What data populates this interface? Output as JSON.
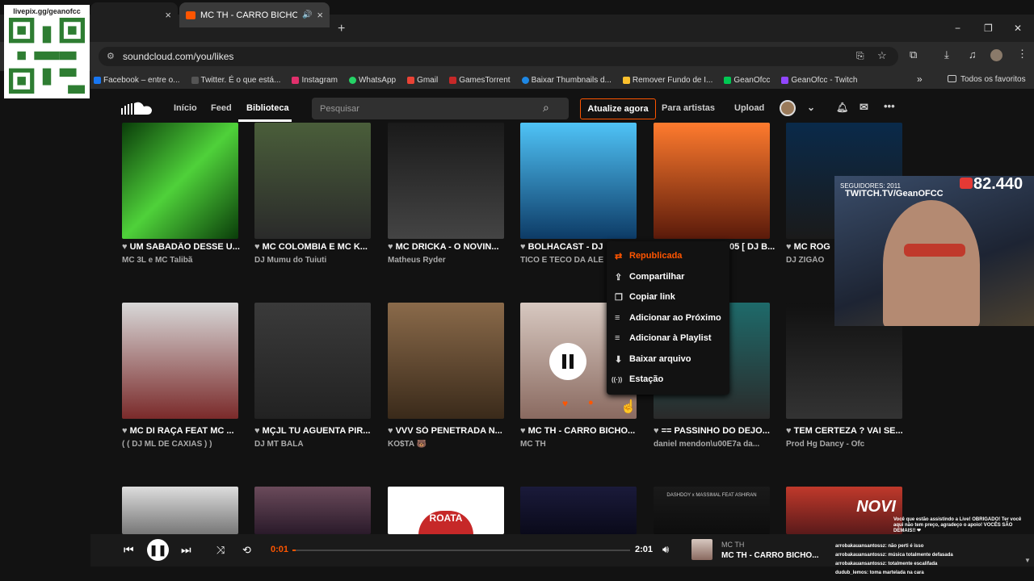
{
  "overlay": {
    "qr_caption": "livepix.gg/geanofcc",
    "followers_label": "SEGUIDORES: 2011",
    "twitch_url": "TWITCH.TV/GeanOFCC",
    "viewer_count": "82.440"
  },
  "tabs": [
    {
      "label": "",
      "close": "×"
    },
    {
      "label": "MC TH - CARRO BICHO DO",
      "close": "×"
    }
  ],
  "new_tab": "+",
  "window_controls": [
    "−",
    "❐",
    "✕"
  ],
  "url": "soundcloud.com/you/likes",
  "bookmarks": [
    {
      "label": "Facebook – entre o...",
      "color": "#1877f2"
    },
    {
      "label": "Twitter. É o que está...",
      "color": "#111111"
    },
    {
      "label": "Instagram",
      "color": "#e1306c"
    },
    {
      "label": "WhatsApp",
      "color": "#25d366"
    },
    {
      "label": "Gmail",
      "color": "#ea4335"
    },
    {
      "label": "GamesTorrent",
      "color": "#c62828"
    },
    {
      "label": "Baixar Thumbnails d...",
      "color": "#1e88e5"
    },
    {
      "label": "Remover Fundo de I...",
      "color": "#fbc02d"
    },
    {
      "label": "GeanOfcc",
      "color": "#00c853"
    },
    {
      "label": "GeanOfcc - Twitch",
      "color": "#9146ff"
    }
  ],
  "bookmarks_more": "»",
  "all_bookmarks": "Todos os favoritos",
  "nav": {
    "home": "Início",
    "feed": "Feed",
    "library": "Biblioteca",
    "search_placeholder": "Pesquisar",
    "upgrade": "Atualize agora",
    "artists": "Para artistas",
    "upload": "Upload"
  },
  "tracks_row1": [
    {
      "title": "UM SABADÃO DESSE U...",
      "artist": "MC 3L e MC Talibã",
      "bg": "linear-gradient(135deg,#0a3d0a,#4fd13a,#0a3d0a)"
    },
    {
      "title": "MC COLOMBIA E MC K...",
      "artist": "DJ Mumu do Tuiuti",
      "bg": "linear-gradient(180deg,#4a5e3a,#2a2a2a)"
    },
    {
      "title": "MC DRICKA - O NOVIN...",
      "artist": "Matheus Ryder",
      "bg": "linear-gradient(180deg,#1a1a1a,#444)"
    },
    {
      "title": "BOLHACAST - DJ",
      "artist": "TICO E TECO DA ALE",
      "bg": "linear-gradient(180deg,#4fc3f7,#0d3b66)"
    },
    {
      "title": "05 [ DJ B...",
      "artist": "",
      "bg": "linear-gradient(180deg,#ff7b2e,#5a1a0a)"
    },
    {
      "title": "MC ROG",
      "artist": "DJ ZIGÃO",
      "bg": "linear-gradient(180deg,#0a2a4a,#1a1a1a)"
    }
  ],
  "tracks_row2": [
    {
      "title": "MC DI RAÇA FEAT MC ...",
      "artist": "( ( DJ ML DE CAXIAS ) )",
      "bg": "linear-gradient(180deg,#d8d8d8,#7a2a2a)"
    },
    {
      "title": "MÇJL TU AGUENTA PIR...",
      "artist": "DJ MT BALA",
      "bg": "linear-gradient(180deg,#3a3a3a,#222)"
    },
    {
      "title": "VVV SÓ PENETRADA N...",
      "artist": "KO$TA 🐻",
      "bg": "linear-gradient(180deg,#8a6a4a,#3a2a1a)"
    },
    {
      "title": "MC TH - CARRO BICHO...",
      "artist": "MC TH",
      "bg": "linear-gradient(180deg,#d7c8c0,#8a6a60)"
    },
    {
      "title": "== PASSINHO DO DEJO...",
      "artist": "daniel mendon\\u00E7a da...",
      "bg": "linear-gradient(180deg,#1e6a6a,#2a2a2a)"
    },
    {
      "title": "TEM CERTEZA ? VAI SE...",
      "artist": "Prod Hg Dancy - Ofc",
      "bg": "linear-gradient(180deg,#111,#333)"
    }
  ],
  "tracks_row3": [
    {
      "bg": "linear-gradient(180deg,#ddd,#777)"
    },
    {
      "bg": "linear-gradient(180deg,#6a4a5a,#2a1a2a)"
    },
    {
      "bg": "#ffffff",
      "label": "ROATA"
    },
    {
      "bg": "linear-gradient(180deg,#1a1a3a,#0a0a1a)"
    },
    {
      "bg": "linear-gradient(180deg,#1a1a1a,#0d0d0d)",
      "label": "DASHDOY x MASSIMAL FEAT ASHIRAN"
    },
    {
      "bg": "linear-gradient(180deg,#c0392b,#5a1a1a)",
      "label": "NOVI"
    }
  ],
  "context_menu": [
    {
      "icon": "⇄",
      "label": "Republicada",
      "active": true
    },
    {
      "icon": "⇪",
      "label": "Compartilhar"
    },
    {
      "icon": "❐",
      "label": "Copiar link"
    },
    {
      "icon": "≡",
      "label": "Adicionar ao Próximo"
    },
    {
      "icon": "≡",
      "label": "Adicionar à Playlist"
    },
    {
      "icon": "⬇",
      "label": "Baixar arquivo"
    },
    {
      "icon": "((·))",
      "label": "Estação"
    }
  ],
  "player": {
    "elapsed": "0:01",
    "duration": "2:01",
    "artist": "MC TH",
    "title": "MC TH - CARRO BICHO...",
    "progress": 0.002
  },
  "chat": [
    "Você que estão assistindo a Live! OBRIGADO! Ter você aqui não tem preço, agradeço o apoio! VOCÊS SÃO DEMAIS!! ❤",
    "arrobakauansantossz: não perti é isso",
    "arrobakauansantossz: música totalmente defasada",
    "arrobakauansantossz: totalmente escalifada",
    "dudub_lemos: toma martelada na cara"
  ],
  "colors": {
    "accent": "#ff5500",
    "bg": "#121212"
  }
}
